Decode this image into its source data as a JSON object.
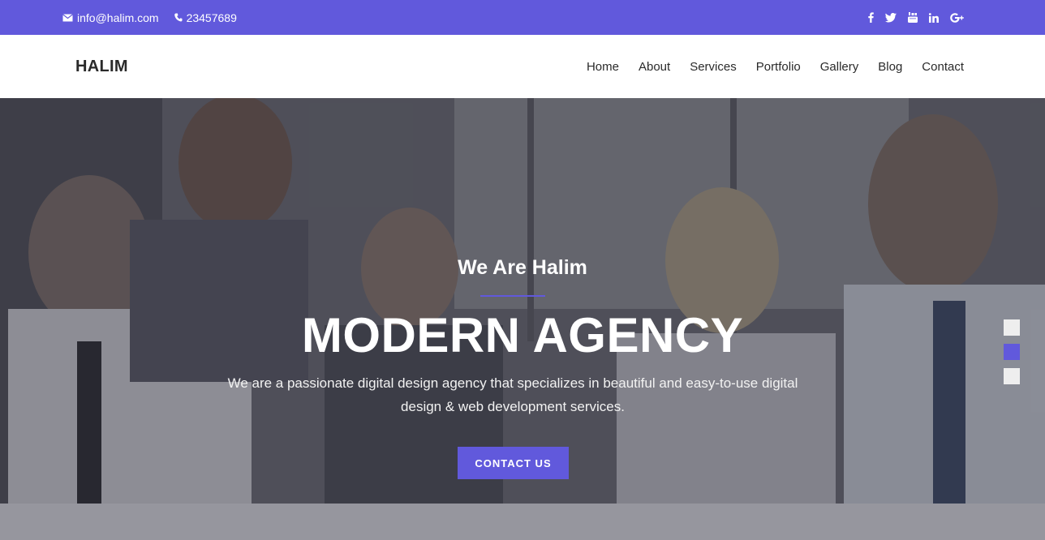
{
  "topbar": {
    "email": "info@halim.com",
    "phone": "23457689",
    "social": [
      {
        "icon": "facebook-icon",
        "glyph": "f"
      },
      {
        "icon": "twitter-icon",
        "glyph": "t"
      },
      {
        "icon": "youtube-icon",
        "glyph": "y"
      },
      {
        "icon": "linkedin-icon",
        "glyph": "in"
      },
      {
        "icon": "google-plus-icon",
        "glyph": "G+"
      }
    ]
  },
  "nav": {
    "logo": "HALIM",
    "items": [
      "Home",
      "About",
      "Services",
      "Portfolio",
      "Gallery",
      "Blog",
      "Contact"
    ]
  },
  "hero": {
    "subtitle": "We Are Halim",
    "headline": "MODERN AGENCY",
    "description": "We are a passionate digital design agency that specializes in beautiful and easy-to-use digital design & web development services.",
    "cta_label": "CONTACT US",
    "slides": 3,
    "active_slide": 2
  },
  "colors": {
    "accent": "#6159dc",
    "nav_text": "#2a2a2a",
    "dot_inactive": "#eeeeee"
  }
}
